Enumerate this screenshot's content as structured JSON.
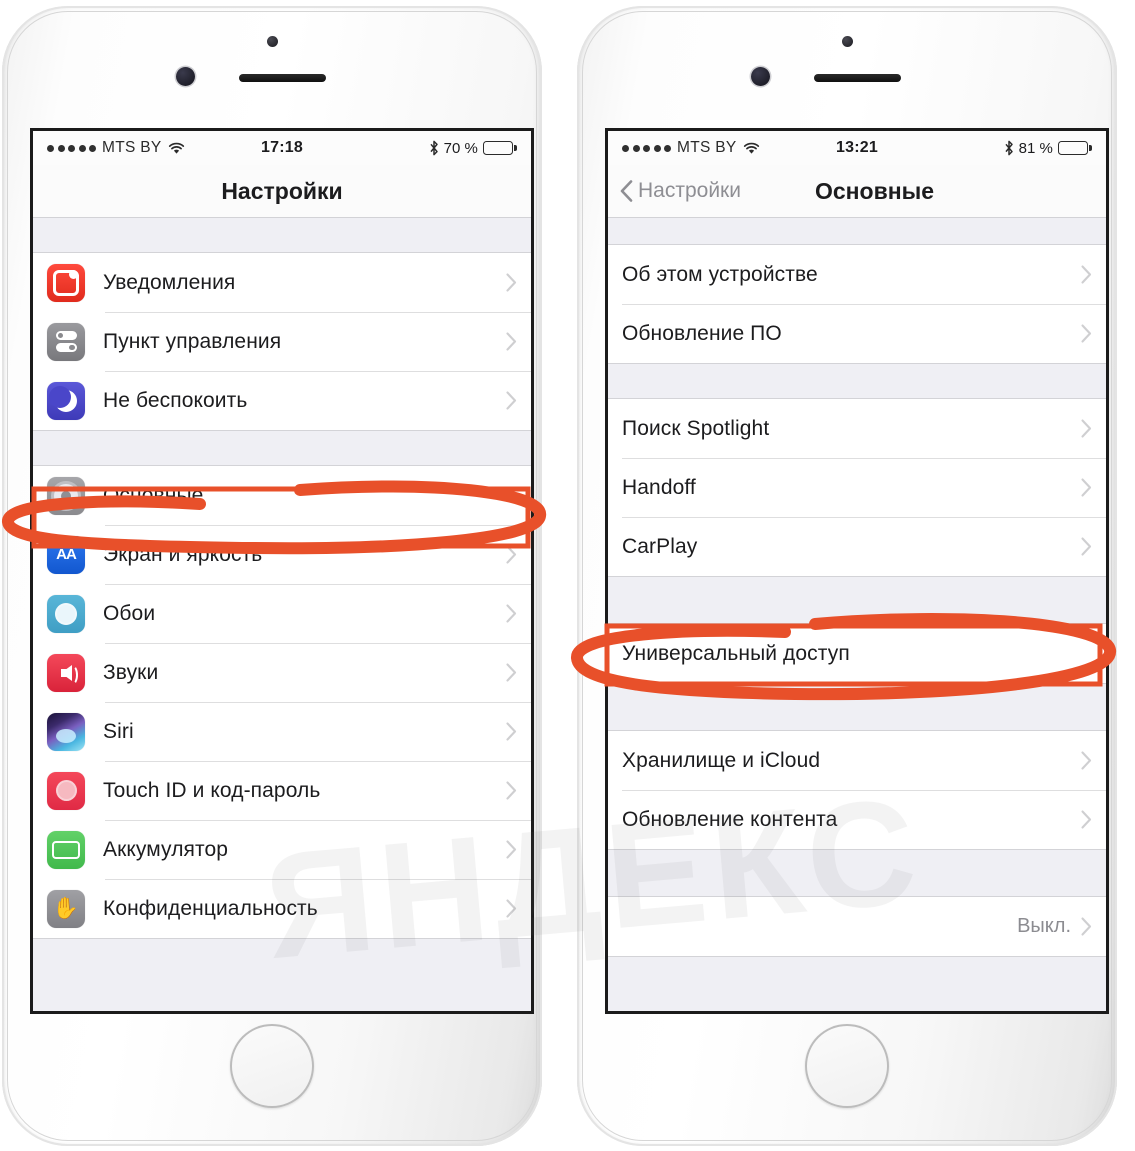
{
  "accent": {
    "annotation": "#E8502A",
    "tint": "#007aff",
    "gray": "#8e8e93"
  },
  "phones": [
    {
      "name": "settings-root",
      "statusbar": {
        "carrier": "MTS BY",
        "signal_dots": 5,
        "wifi_icon": "wifi-icon",
        "time": "17:18",
        "bluetooth_icon": "bluetooth-icon",
        "battery_percent": "70 %",
        "battery_level": 70
      },
      "navbar": {
        "title": "Настройки",
        "back_label": null
      },
      "sections": [
        {
          "name": "notifications-group",
          "rows": [
            {
              "label": "Уведомления",
              "icon": "notifications-icon",
              "icon_class": "ic-notif",
              "chevron": true,
              "value": null
            },
            {
              "label": "Пункт управления",
              "icon": "control-center-icon",
              "icon_class": "ic-cc",
              "chevron": true,
              "value": null
            },
            {
              "label": "Не беспокоить",
              "icon": "do-not-disturb-icon",
              "icon_class": "ic-dnd",
              "chevron": true,
              "value": null
            }
          ]
        },
        {
          "name": "general-group",
          "rows": [
            {
              "label": "Основные",
              "icon": "general-gear-icon",
              "icon_class": "ic-gen",
              "chevron": false,
              "value": null,
              "highlighted": true
            },
            {
              "label": "Экран и яркость",
              "icon": "display-brightness-icon",
              "icon_class": "ic-disp",
              "chevron": true,
              "value": null
            },
            {
              "label": "Обои",
              "icon": "wallpaper-icon",
              "icon_class": "ic-wall",
              "chevron": true,
              "value": null
            },
            {
              "label": "Звуки",
              "icon": "sounds-icon",
              "icon_class": "ic-snd",
              "chevron": true,
              "value": null
            },
            {
              "label": "Siri",
              "icon": "siri-icon",
              "icon_class": "ic-siri",
              "chevron": true,
              "value": null
            },
            {
              "label": "Touch ID и код-пароль",
              "icon": "touch-id-icon",
              "icon_class": "ic-touch",
              "chevron": true,
              "value": null
            },
            {
              "label": "Аккумулятор",
              "icon": "battery-icon",
              "icon_class": "ic-batt",
              "chevron": true,
              "value": null
            },
            {
              "label": "Конфиденциальность",
              "icon": "privacy-hand-icon",
              "icon_class": "ic-priv",
              "chevron": true,
              "value": null
            }
          ]
        }
      ]
    },
    {
      "name": "general-screen",
      "statusbar": {
        "carrier": "MTS BY",
        "signal_dots": 5,
        "wifi_icon": "wifi-icon",
        "time": "13:21",
        "bluetooth_icon": "bluetooth-icon",
        "battery_percent": "81 %",
        "battery_level": 81
      },
      "navbar": {
        "title": "Основные",
        "back_label": "Настройки"
      },
      "sections": [
        {
          "name": "about-group",
          "rows": [
            {
              "label": "Об этом устройстве",
              "icon": null,
              "icon_class": null,
              "chevron": true,
              "value": null
            },
            {
              "label": "Обновление ПО",
              "icon": null,
              "icon_class": null,
              "chevron": true,
              "value": null
            }
          ]
        },
        {
          "name": "spotlight-group",
          "rows": [
            {
              "label": "Поиск Spotlight",
              "icon": null,
              "icon_class": null,
              "chevron": true,
              "value": null
            },
            {
              "label": "Handoff",
              "icon": null,
              "icon_class": null,
              "chevron": true,
              "value": null
            },
            {
              "label": "CarPlay",
              "icon": null,
              "icon_class": null,
              "chevron": true,
              "value": null
            }
          ]
        },
        {
          "name": "accessibility-group",
          "rows": [
            {
              "label": "Универсальный доступ",
              "icon": null,
              "icon_class": null,
              "chevron": false,
              "value": null,
              "highlighted": true
            }
          ]
        },
        {
          "name": "storage-group",
          "rows": [
            {
              "label": "Хранилище и iCloud",
              "icon": null,
              "icon_class": null,
              "chevron": true,
              "value": null
            },
            {
              "label": "Обновление контента",
              "icon": null,
              "icon_class": null,
              "chevron": true,
              "value": null
            }
          ]
        },
        {
          "name": "restrictions-group",
          "rows": [
            {
              "label": "",
              "icon": null,
              "icon_class": null,
              "chevron": true,
              "value": "Выкл."
            }
          ]
        }
      ]
    }
  ],
  "watermark": {
    "text": "ЯНДЕКС"
  },
  "annotations": [
    {
      "name": "highlight-osnovnye",
      "type": "rect-and-ellipse",
      "target": "Основные"
    },
    {
      "name": "highlight-universalnyi-dostup",
      "type": "rect-and-ellipse",
      "target": "Универсальный доступ"
    }
  ]
}
